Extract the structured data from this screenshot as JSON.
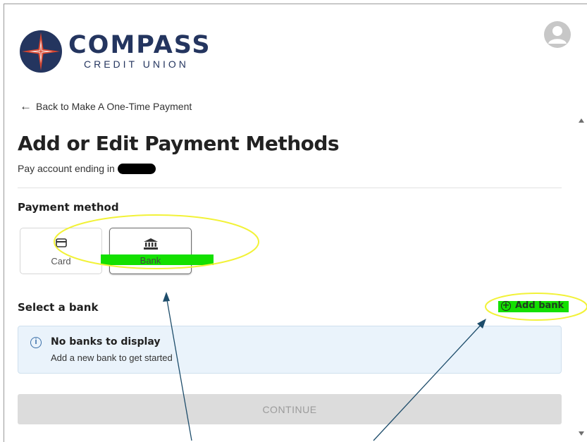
{
  "brand": {
    "name": "COMPASS",
    "subtitle": "CREDIT UNION"
  },
  "nav": {
    "back_link": "Back to Make A One-Time Payment"
  },
  "page": {
    "title": "Add or Edit Payment Methods",
    "account_line": "Pay account ending in"
  },
  "payment_method": {
    "label": "Payment method",
    "options": [
      {
        "label": "Card",
        "icon": "credit-card-icon",
        "selected": false
      },
      {
        "label": "Bank",
        "icon": "bank-icon",
        "selected": true
      }
    ]
  },
  "select_bank": {
    "label": "Select a bank",
    "add_bank_label": "Add bank"
  },
  "notice": {
    "title": "No banks to display",
    "message": "Add a new bank to get started"
  },
  "actions": {
    "continue_label": "CONTINUE",
    "continue_disabled": true
  },
  "colors": {
    "brand_navy": "#24355f",
    "brand_red": "#d9462f",
    "highlight_green": "#13e000",
    "annotation_yellow": "#f2f238",
    "arrow_color": "#1e4d6b",
    "notice_bg": "#eaf3fb",
    "button_disabled": "#dcdcdc"
  }
}
